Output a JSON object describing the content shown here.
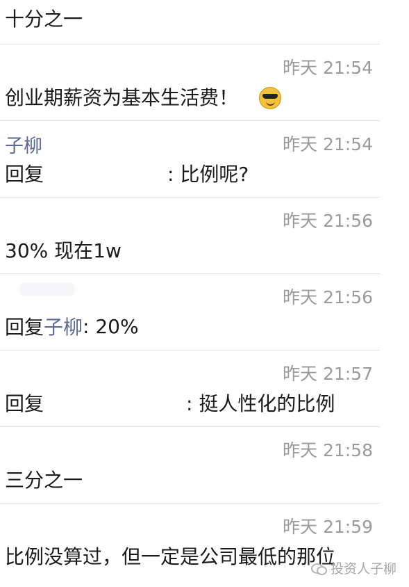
{
  "feed": {
    "items": [
      {
        "body": "十分之一"
      },
      {
        "time": "昨天 21:54",
        "body": "创业期薪资为基本生活费！",
        "emoji": "sunglasses-emoji"
      },
      {
        "name": "子柳",
        "time": "昨天 21:54",
        "reply_prefix": "回复",
        "reply_suffix": ": 比例呢?"
      },
      {
        "time": "昨天 21:56",
        "body": "30% 现在1w"
      },
      {
        "time": "昨天 21:56",
        "reply_prefix": "回复",
        "mention": "子柳",
        "reply_suffix": ": 20%"
      },
      {
        "time": "昨天 21:57",
        "reply_prefix": "回复",
        "reply_suffix": ": 挺人性化的比例"
      },
      {
        "time": "昨天 21:58",
        "body": "三分之一"
      },
      {
        "time": "昨天 21:59",
        "body": "比例没算过，但一定是公司最低的那位"
      }
    ]
  },
  "watermark": {
    "text": "投资人子柳",
    "icon": "wechat-icon"
  }
}
